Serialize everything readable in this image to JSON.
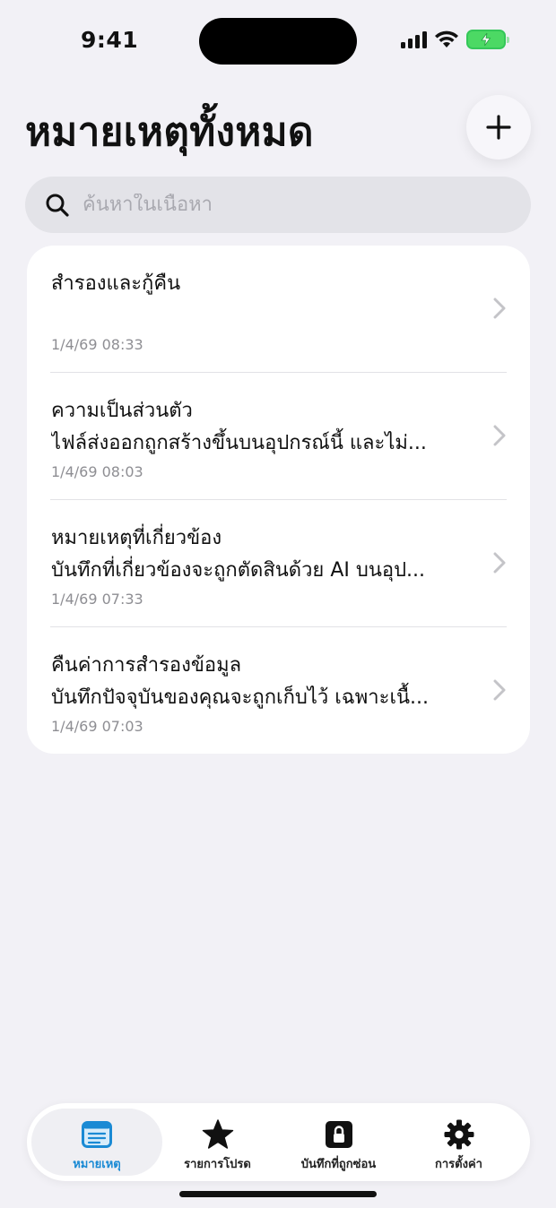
{
  "status": {
    "time": "9:41"
  },
  "header": {
    "title": "หมายเหตุทั้งหมด"
  },
  "search": {
    "placeholder": "ค้นหาในเนื้อหา"
  },
  "notes": [
    {
      "title": "สำรองและกู้คืน",
      "preview": "",
      "date": "1/4/69 08:33"
    },
    {
      "title": "ความเป็นส่วนตัว",
      "preview": "ไฟล์ส่งออกถูกสร้างขึ้นบนอุปกรณ์นี้ และไม่...",
      "date": "1/4/69 08:03"
    },
    {
      "title": "หมายเหตุที่เกี่ยวข้อง",
      "preview": "บันทึกที่เกี่ยวข้องจะถูกตัดสินด้วย AI บนอุป...",
      "date": "1/4/69 07:33"
    },
    {
      "title": "คืนค่าการสำรองข้อมูล",
      "preview": "บันทึกปัจจุบันของคุณจะถูกเก็บไว้ เฉพาะเนื้...",
      "date": "1/4/69 07:03"
    }
  ],
  "tabs": [
    {
      "label": "หมายเหตุ",
      "icon": "notes-icon",
      "active": true
    },
    {
      "label": "รายการโปรด",
      "icon": "star-icon",
      "active": false
    },
    {
      "label": "บันทึกที่ถูกซ่อน",
      "icon": "lock-icon",
      "active": false
    },
    {
      "label": "การตั้งค่า",
      "icon": "gear-icon",
      "active": false
    }
  ],
  "colors": {
    "accent": "#1a8ad4",
    "background": "#f2f1f6",
    "battery": "#4cd964"
  }
}
